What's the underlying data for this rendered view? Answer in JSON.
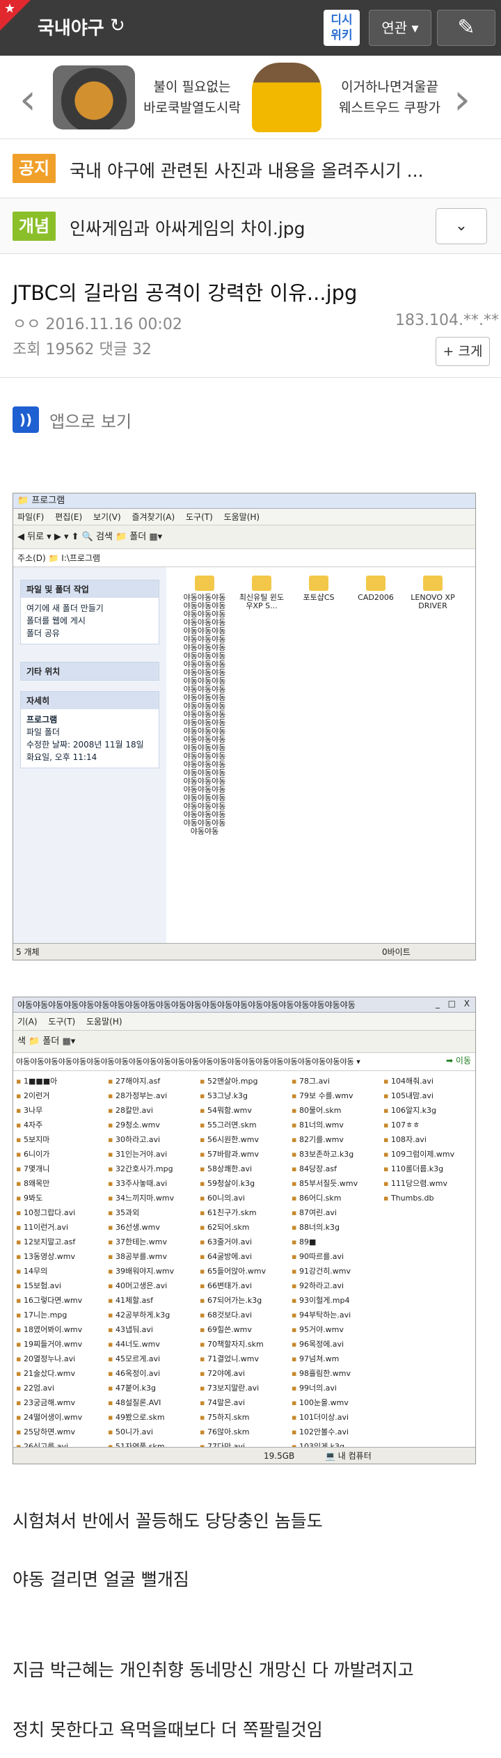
{
  "header": {
    "board_title": "국내야구",
    "refresh_icon": "refresh-icon",
    "dc_wiki_line1": "디시",
    "dc_wiki_line2": "위키",
    "related_label": "연관 ▾",
    "write_icon": "pencil-icon"
  },
  "ad": {
    "left_text_1": "불이 필요없는",
    "left_text_2": "바로쿡발열도시락",
    "right_text_1": "이거하나면겨울끝",
    "right_text_2": "웨스트우드 쿠팡가"
  },
  "notice": {
    "badge": "공지",
    "text": "국내 야구에 관련된 사진과 내용을 올려주시기 ..."
  },
  "concept": {
    "badge": "개념",
    "text": "인싸게임과 아싸게임의 차이.jpg"
  },
  "post": {
    "title": "JTBC의 길라임 공격이 강력한 이유...jpg",
    "author_date": "ㅇㅇ 2016.11.16 00:02",
    "ip": "183.104.**.**",
    "stats": "조회 19562 댓글 32",
    "enlarge_label": "+ 크게"
  },
  "app_view": {
    "logo": "))",
    "label": "앱으로 보기"
  },
  "screenshot1": {
    "title": "프로그램",
    "menu": "파일(F) 편집(E) 보기(V) 즐겨찾기(A) 도구(T) 도움말(H)",
    "toolbar": "◀ 뒤로 ▾  ▶ ▾  ⬆  🔍 검색  📁 폴더  ▦▾",
    "address": "주소(D)  📁 I:\\프로그램",
    "panel1_title": "파일 및 폴더 작업",
    "panel1_items": [
      "여기에 새 폴더 만들기",
      "폴더를 웹에 게시",
      "폴더 공유"
    ],
    "panel2_title": "기타 위치",
    "panel3_title": "자세히",
    "panel3_name": "프로그램",
    "panel3_type": "파일 폴더",
    "panel3_modified": "수정한 날짜: 2008년 11월 18일 화요일, 오후 11:14",
    "folders": [
      "야동야동야동야동야동야동야동야동야동야동야동야동야동야동야동야동야동야동야동야동야동야동야동야동야동야동야동야동야동야동야동야동야동야동야동야동야동야동야동야동야동야동야동야동야동야동야동야동야동야동야동야동야동야동야동야동야동야동야동야동야동야동야동야동야동야동야동야동야동야동야동야동야동야동야동야동야동야동야동야동야동야동야동야동야동야동",
      "최신유틸 윈도우XP S...",
      "포토샵CS",
      "CAD2006",
      "LENOVO XP DRIVER"
    ],
    "status_left": "5 개체",
    "status_right": "0바이트"
  },
  "screenshot2": {
    "title": "야동야동야동야동야동야동야동야동야동야동야동야동야동야동야동야동야동야동야동야동야동야동",
    "winbtns": "_ □ X",
    "menu": "기(A) 도구(T) 도움말(H)",
    "toolbar": "색 📁 폴더  ▦▾",
    "address": "야동야동야동야동야동야동야동야동야동야동야동야동야동야동야동야동야동야동야동야동야동야동야동야동 ▾",
    "go_label": "➡ 이동",
    "columns": [
      [
        "1■■■아",
        "2이런거",
        "3나무",
        "4자주",
        "5보지마",
        "6니이가",
        "7몇개니",
        "8왜목만",
        "9봐도",
        "10정그랍다.avi",
        "11이런거.avi",
        "12보지말고.asf",
        "13동영상.wmv",
        "14무의",
        "15보험.avi",
        "16그렇다면.wmv",
        "17니는.mpg",
        "18였어봐이.wmv",
        "19찌들거야.wmv",
        "20열정누나.avi",
        "21술샀다.wmv",
        "22엄.avi",
        "23궁금해.wmv",
        "24떨어생이.wmv",
        "25당하면.wmv",
        "26신고를.avi"
      ],
      [
        "27해야지.asf",
        "28가정부는.avi",
        "28칼만.avi",
        "29청소.wmv",
        "30하라고.avi",
        "31인는거야.avi",
        "32간호사가.mpg",
        "33주사놓때.avi",
        "34느끼지마.wmv",
        "35과외",
        "36선생.wmv",
        "37한테는.wmv",
        "38공부를.wmv",
        "39배워야지.wmv",
        "40머고생은.avi",
        "41체할.asf",
        "42공부하게.k3g",
        "43냅둬.avi",
        "44너도.wmv",
        "45모르게.avi",
        "46옥정이.avi",
        "47붙어.k3g",
        "48설질론.AVI",
        "49봤으로.skm",
        "50니가.avi",
        "51자연풀.skm"
      ],
      [
        "52맨살아.mpg",
        "53그냥.k3g",
        "54뭐함.wmv",
        "55그러면.skm",
        "56시원한.wmv",
        "57바람과.wmv",
        "58상쾌한.avi",
        "59청살이.k3g",
        "60니의.avi",
        "61친구가.skm",
        "62되어.skm",
        "63줄거야.avi",
        "64굴방에.avi",
        "65들어앉아.wmv",
        "66변태가.avi",
        "67되어가는.k3g",
        "68것보다.avi",
        "69힐쓴.wmv",
        "70책할자지.skm",
        "71결었니.wmv",
        "72야에.avi",
        "73보지말란.avi",
        "74말은.avi",
        "75하지.skm",
        "76않아.skm",
        "77다만.avi"
      ],
      [
        "78그.avi",
        "79보 수를.wmv",
        "80물어.skm",
        "81너의.wmv",
        "82기를.wmv",
        "83보존하고.k3g",
        "84당장.asf",
        "85부서질듯.wmv",
        "86어디.skm",
        "87여린.avi",
        "88너의.k3g",
        "89■",
        "90따르를.avi",
        "91강건히.wmv",
        "92하라고.avi",
        "93이헐게.mp4",
        "94부탁하는.avi",
        "95거야.wmv",
        "96목정에.avi",
        "97넘쳐.wm",
        "98흘림한.wmv",
        "99너의.avi",
        "100눈을.wmv",
        "101더이상.avi",
        "102안볼수.avi",
        "103있게.k3g"
      ],
      [
        "104해줘.avi",
        "105내맘.avi",
        "106알지.k3g",
        "107ㅎㅎ",
        "108자.avi",
        "109그럼이제.wmv",
        "110롤더름.k3g",
        "111당으렴.wmv",
        "Thumbs.db"
      ]
    ],
    "status_size": "19.5GB",
    "status_pc": "💻 내 컴퓨터"
  },
  "body_lines": [
    "시험쳐서 반에서 꼴등해도 당당충인 놈들도",
    "야동 걸리면 얼굴 뻘개짐",
    "지금 박근혜는 개인취향 동네망신 개망신 다 까발려지고",
    "정치 못한다고 욕먹을때보다 더 쪽팔릴것임"
  ]
}
